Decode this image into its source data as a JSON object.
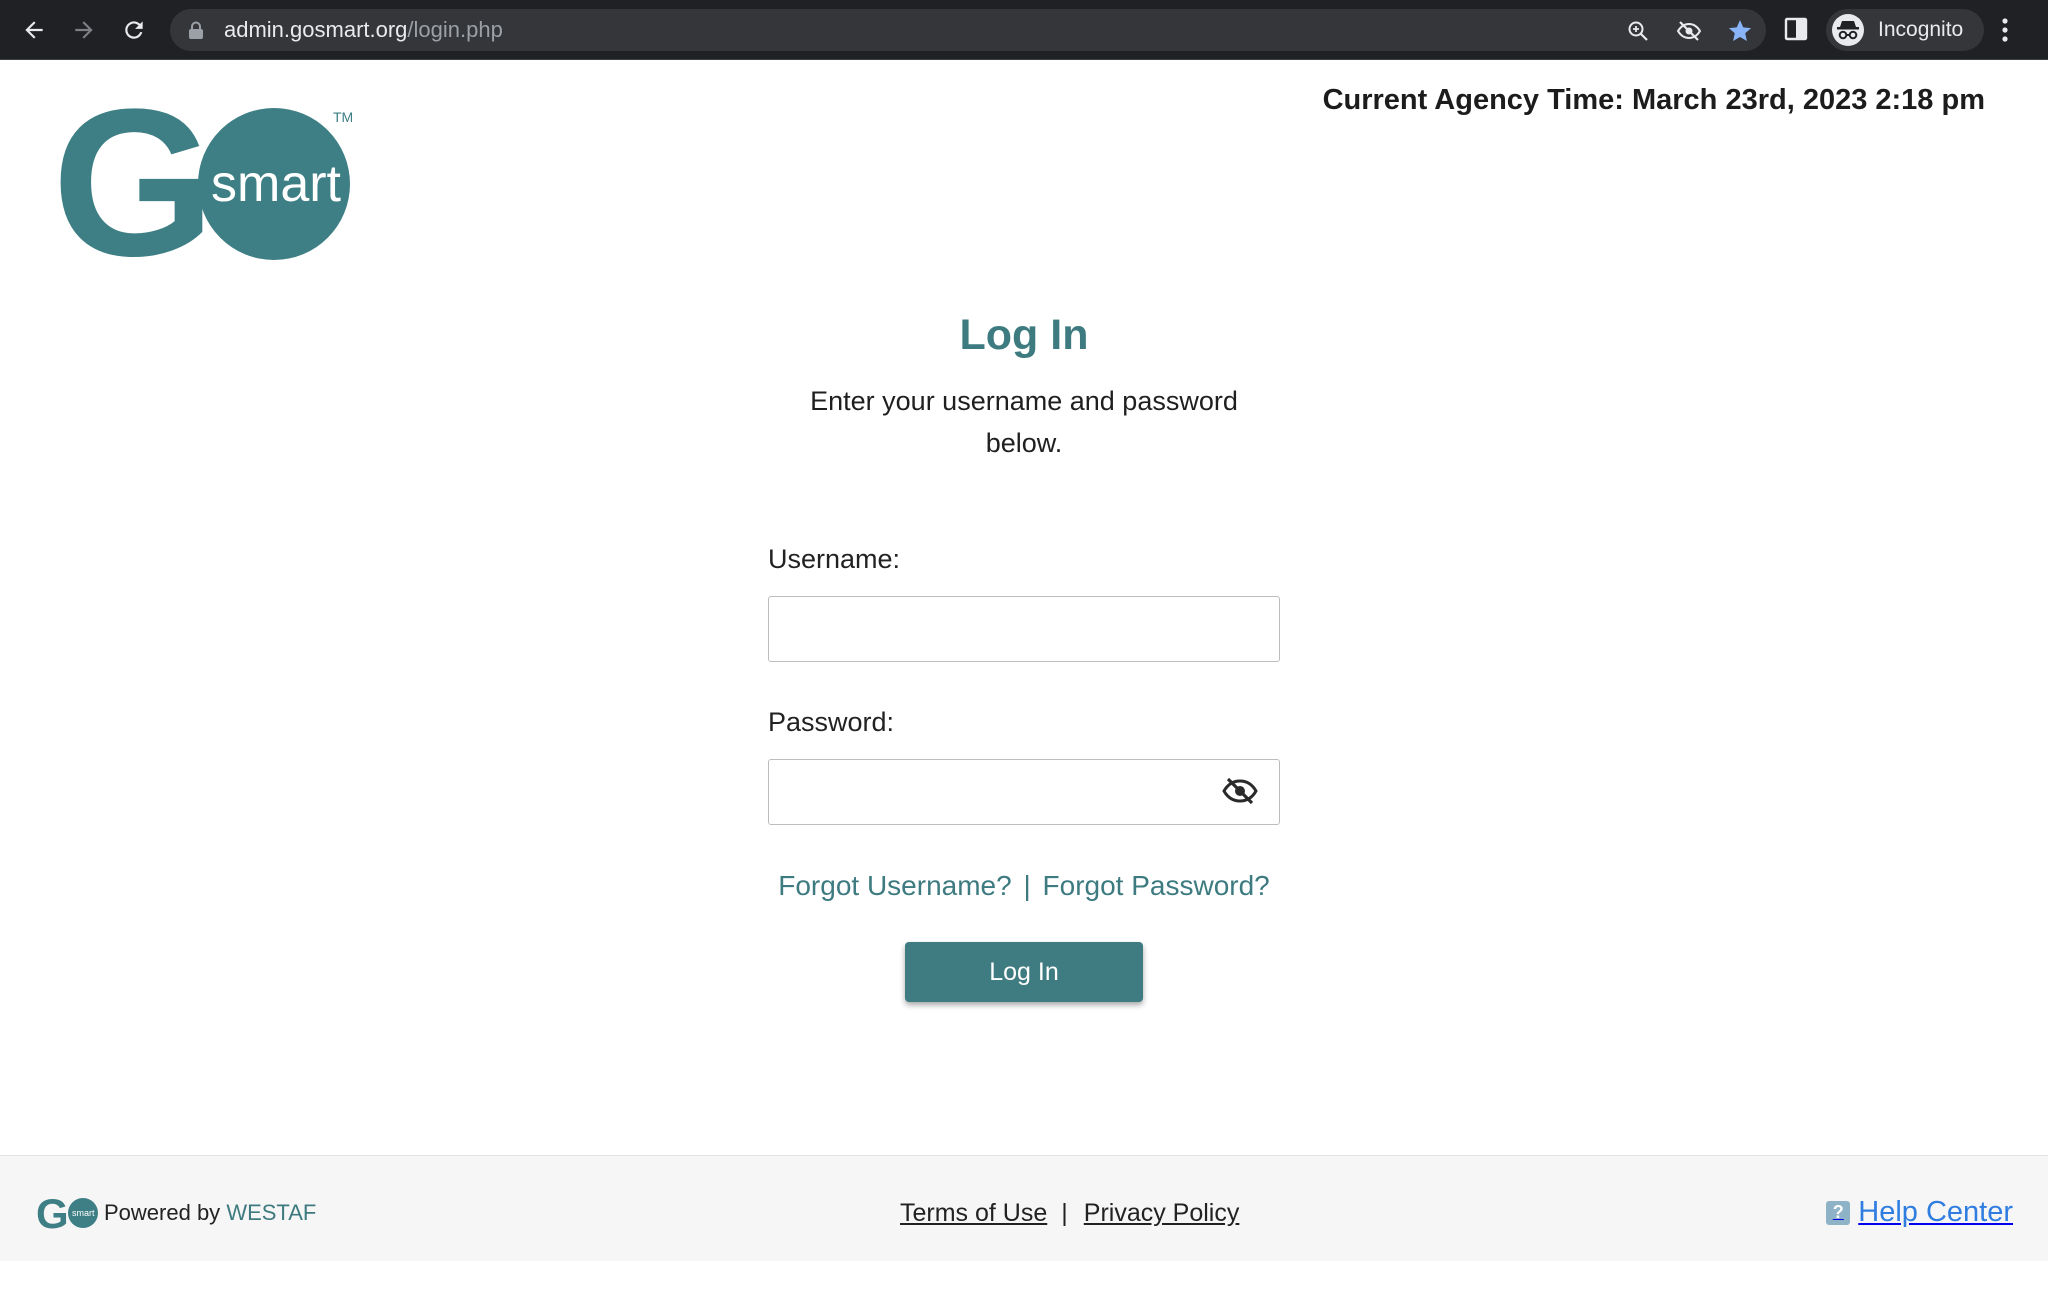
{
  "browser": {
    "url_host": "admin.gosmart.org",
    "url_path": "/login.php",
    "profile_label": "Incognito",
    "icons": [
      "back-icon",
      "forward-icon",
      "reload-icon",
      "lock-icon",
      "zoom-icon",
      "eye-off-icon",
      "bookmark-star-icon",
      "side-panel-icon",
      "incognito-icon",
      "more-menu-icon"
    ]
  },
  "header": {
    "logo_main": "G",
    "logo_circle": "smart",
    "logo_tm": "TM",
    "agency_time": "Current Agency Time: March 23rd, 2023 2:18 pm"
  },
  "login": {
    "title": "Log In",
    "subtitle": "Enter your username and password below.",
    "username_label": "Username:",
    "username_value": "",
    "password_label": "Password:",
    "password_value": "",
    "forgot_username": "Forgot Username?",
    "forgot_separator": "|",
    "forgot_password": "Forgot Password?",
    "submit_label": "Log In"
  },
  "footer": {
    "powered_prefix": "Powered by",
    "powered_brand": "WESTAF",
    "terms_label": "Terms of Use",
    "links_separator": "|",
    "privacy_label": "Privacy Policy",
    "help_icon_glyph": "?",
    "help_label": "Help Center"
  },
  "colors": {
    "brand_teal": "#3f7c82",
    "link_blue": "#2f7de1",
    "chrome_bg": "#202124"
  }
}
